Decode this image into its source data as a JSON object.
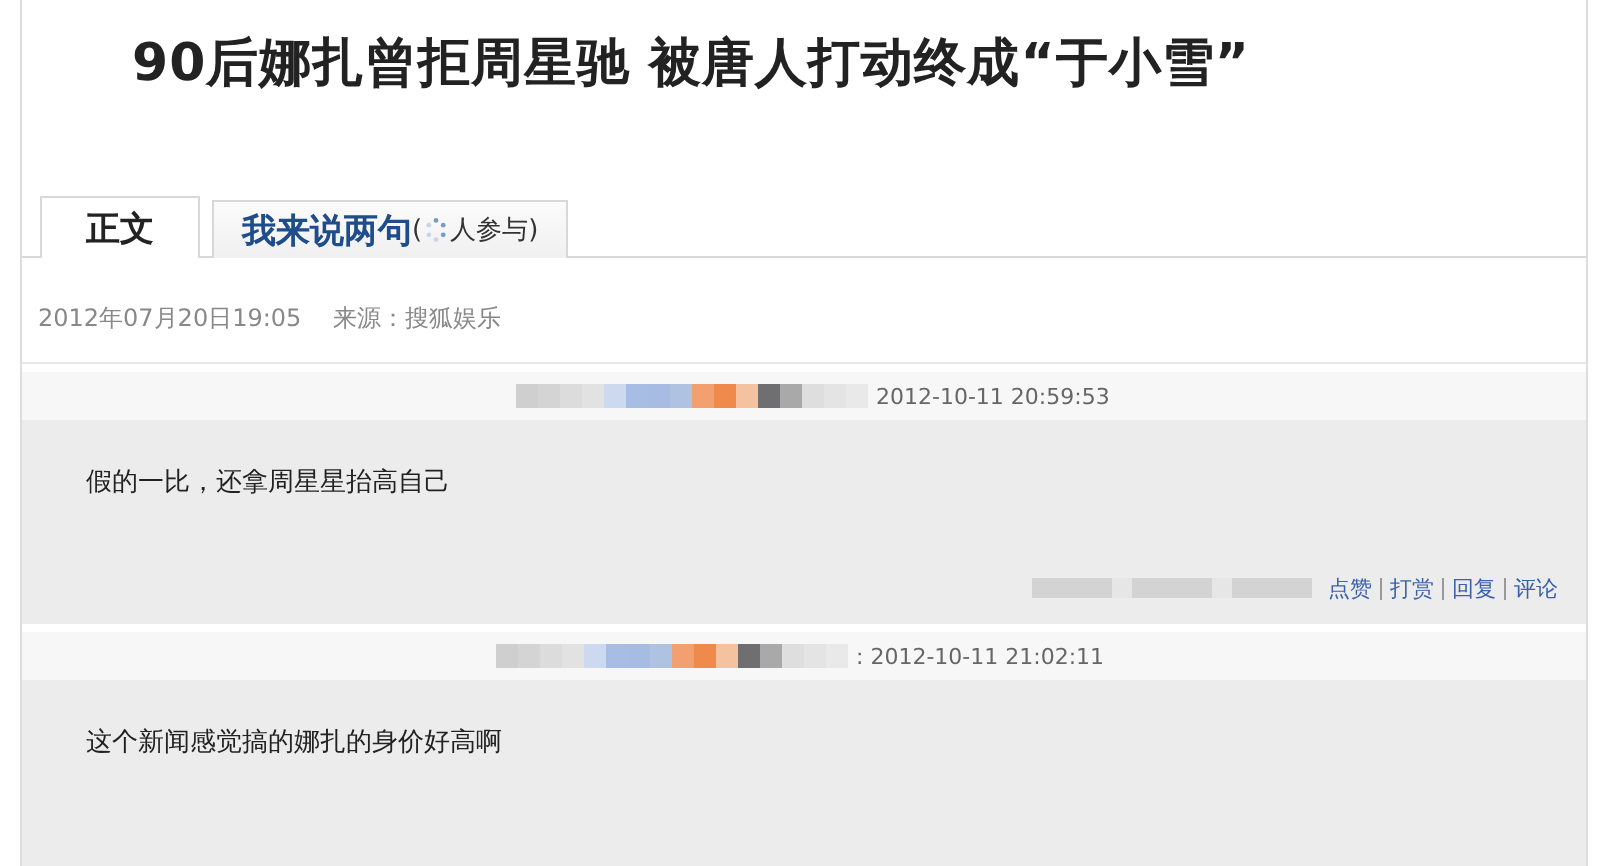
{
  "article": {
    "title": "90后娜扎曾拒周星驰  被唐人打动终成“于小雪”"
  },
  "tabs": [
    {
      "label": "正文",
      "selected": true
    },
    {
      "label": "我来说两句",
      "selected": false,
      "count_open": "(",
      "count_note": "人参与)"
    }
  ],
  "meta": {
    "date": "2012年07月20日19:05",
    "source": "来源：搜狐娱乐"
  },
  "comments": [
    {
      "time": "2012-10-11 20:59:53",
      "text": "假的一比，还拿周星星抬高自己",
      "actions": [
        "点赞",
        "打赏",
        "回复",
        "评论"
      ]
    },
    {
      "time": ": 2012-10-11 21:02:11",
      "text": "这个新闻感觉搞的娜扎的身价好高啊"
    }
  ]
}
